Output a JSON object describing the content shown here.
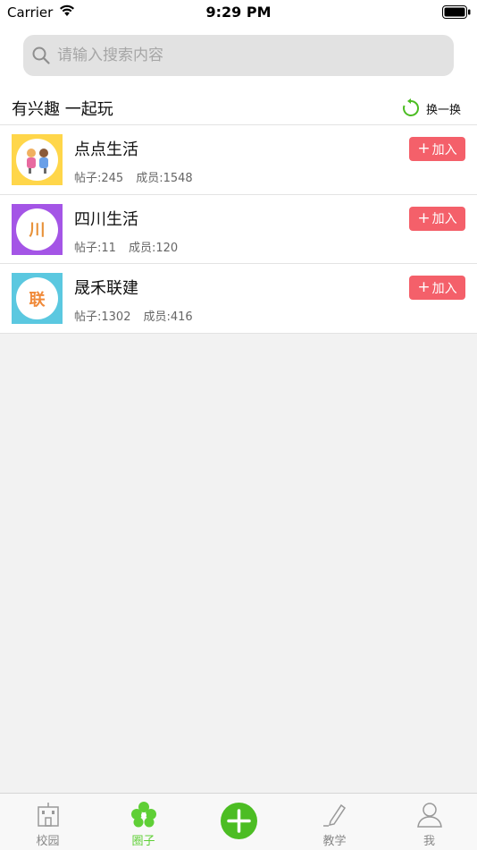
{
  "status_bar": {
    "carrier": "Carrier",
    "time": "9:29 PM"
  },
  "search": {
    "placeholder": "请输入搜索内容",
    "value": ""
  },
  "section": {
    "title": "有兴趣 一起玩",
    "refresh_label": "换一换"
  },
  "groups": [
    {
      "name": "点点生活",
      "posts": "帖子:245",
      "members": "成员:1548",
      "join_label": "加入",
      "avatar_color": "#ffd64a",
      "avatar_text": ""
    },
    {
      "name": "四川生活",
      "posts": "帖子:11",
      "members": "成员:120",
      "join_label": "加入",
      "avatar_color": "#a455e6",
      "avatar_text": "川"
    },
    {
      "name": "晟禾联建",
      "posts": "帖子:1302",
      "members": "成员:416",
      "join_label": "加入",
      "avatar_color": "#5bc8e0",
      "avatar_text": "联"
    }
  ],
  "tabs": [
    {
      "label": "校园",
      "icon": "building-icon"
    },
    {
      "label": "圈子",
      "icon": "clover-icon",
      "active": true
    },
    {
      "label": "",
      "icon": "add-icon"
    },
    {
      "label": "教学",
      "icon": "pen-icon"
    },
    {
      "label": "我",
      "icon": "person-icon"
    }
  ],
  "colors": {
    "accent_green": "#5fcf36",
    "join_red": "#f4606a",
    "add_green": "#4cbd23"
  }
}
